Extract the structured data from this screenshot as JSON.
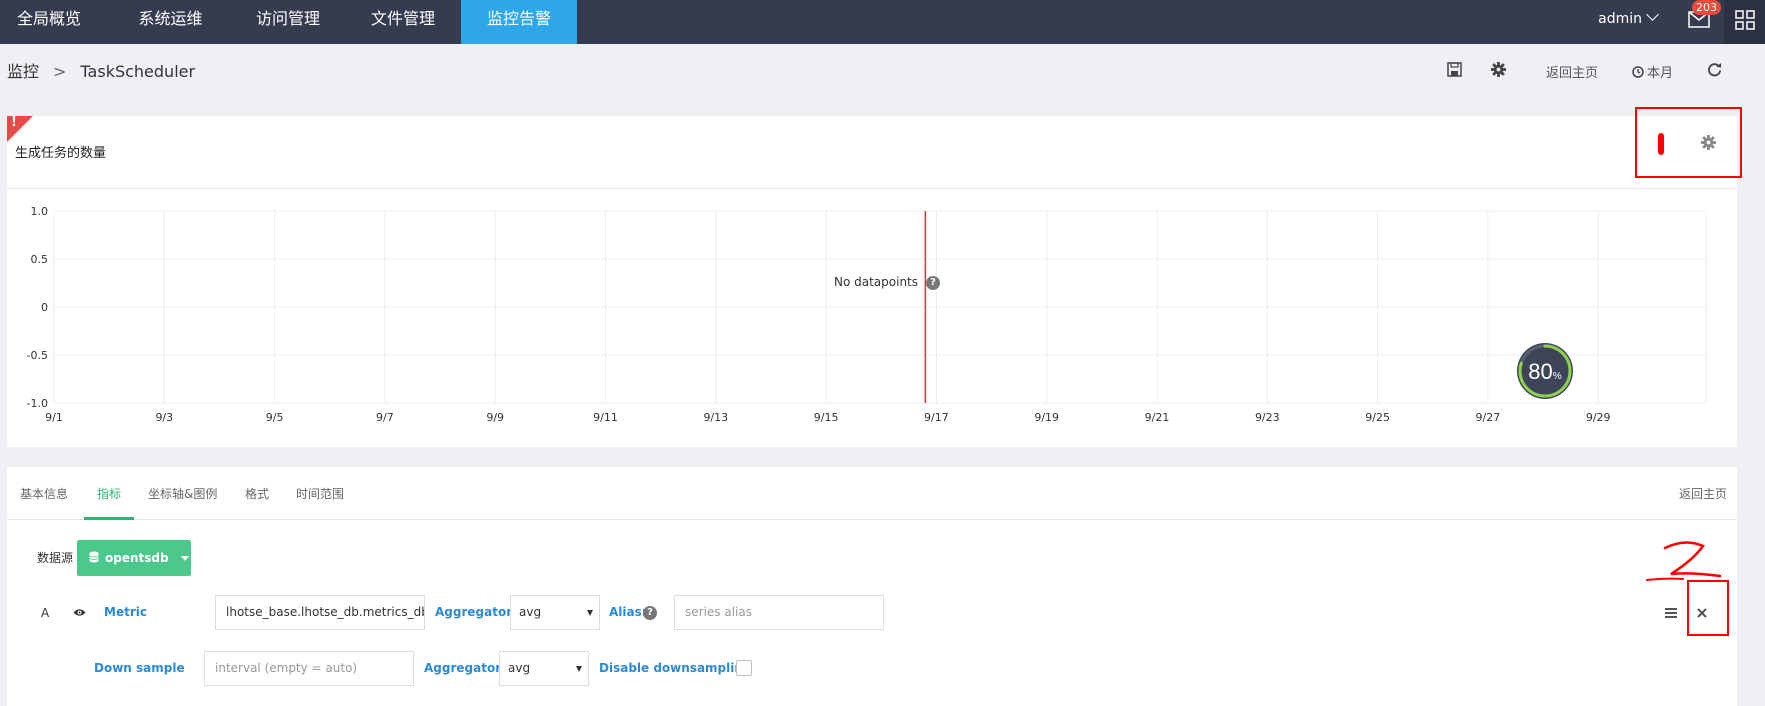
{
  "nav": {
    "items": [
      "全局概览",
      "系统运维",
      "访问管理",
      "文件管理",
      "监控告警"
    ],
    "active_index": 4,
    "user": "admin",
    "mail_badge": "203"
  },
  "breadcrumb": {
    "root": "监控",
    "separator": ">",
    "current": "TaskScheduler"
  },
  "toolbar": {
    "back_home": "返回主页",
    "time_range": "本月"
  },
  "panel": {
    "alert_mark": "!",
    "title": "生成任务的数量",
    "no_data_text": "No datapoints",
    "help_glyph": "?"
  },
  "chart_data": {
    "type": "line",
    "title": "生成任务的数量",
    "series": [],
    "y_ticks": [
      "1.0",
      "0.5",
      "0",
      "-0.5",
      "-1.0"
    ],
    "x_ticks": [
      "9/1",
      "9/3",
      "9/5",
      "9/7",
      "9/9",
      "9/11",
      "9/13",
      "9/15",
      "9/17",
      "9/19",
      "9/21",
      "9/23",
      "9/25",
      "9/27",
      "9/29"
    ],
    "ylim": [
      -1.0,
      1.0
    ],
    "grid": true,
    "marker_line_x": "9/15"
  },
  "gauge": {
    "value": "80",
    "unit": "%",
    "fraction": 0.8
  },
  "editor": {
    "tabs": [
      "基本信息",
      "指标",
      "坐标轴&图例",
      "格式",
      "时间范围"
    ],
    "active_tab": 1,
    "back_home": "返回主页",
    "datasource_label": "数据源",
    "datasource_value": "opentsdb",
    "query": {
      "ref_id": "A",
      "metric_label": "Metric",
      "metric_value": "lhotse_base.lhotse_db.metrics_db.i",
      "aggregator_label": "Aggregator",
      "aggregator_value": "avg",
      "alias_label": "Alias:",
      "alias_placeholder": "series alias",
      "downsample_label": "Down sample",
      "downsample_placeholder": "interval (empty = auto)",
      "downsample_aggregator_label": "Aggregator",
      "downsample_aggregator_value": "avg",
      "disable_downsampling_label": "Disable downsampling"
    }
  },
  "colors": {
    "nav_bg": "#363c4f",
    "nav_active": "#2ea7e8",
    "accent_green": "#4bc98c",
    "label_blue": "#2a8ad8",
    "annotation_red": "#ff0000"
  }
}
